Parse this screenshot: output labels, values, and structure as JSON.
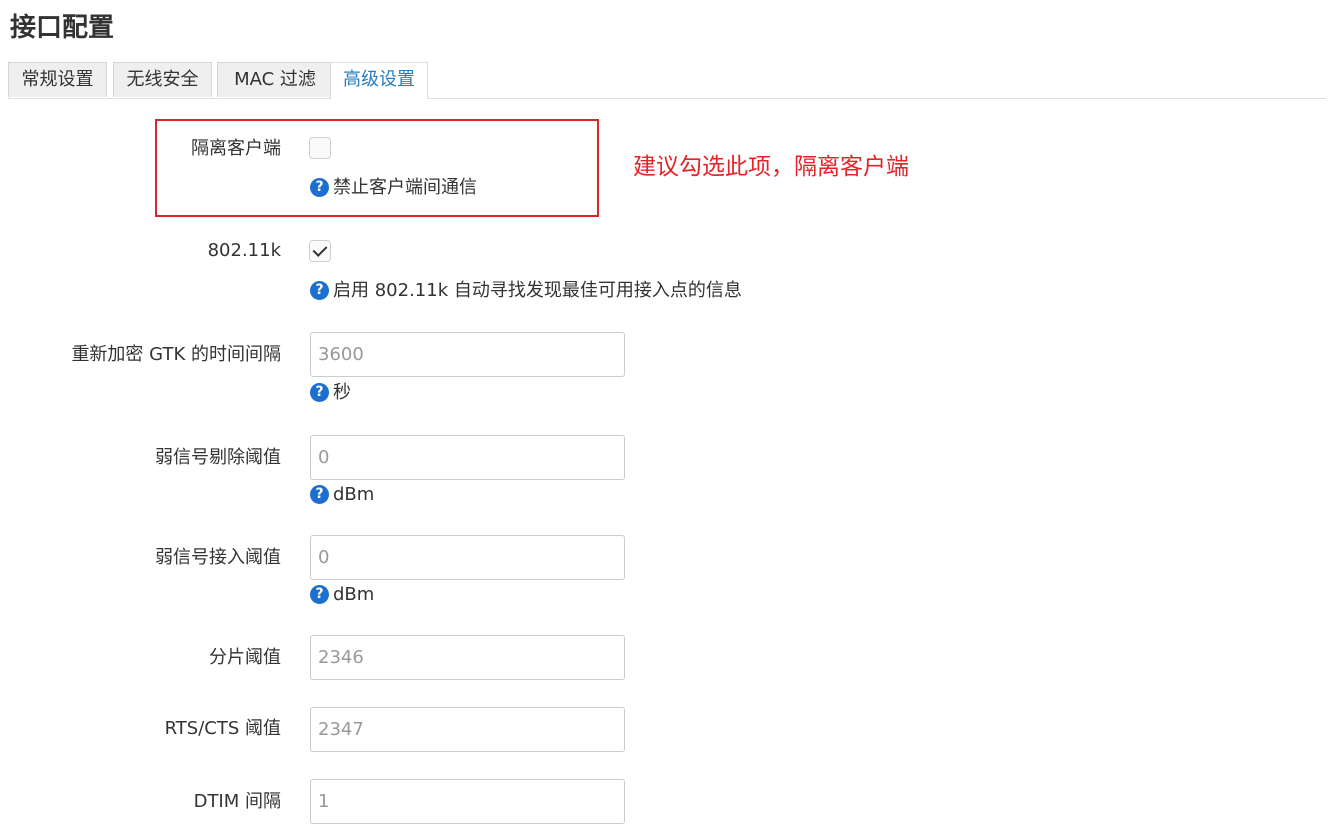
{
  "page": {
    "title": "接口配置"
  },
  "tabs": [
    {
      "label": "常规设置"
    },
    {
      "label": "无线安全"
    },
    {
      "label": "MAC 过滤"
    },
    {
      "label": "高级设置",
      "active": true
    }
  ],
  "annotation": {
    "text": "建议勾选此项，隔离客户端",
    "color": "#e5232a"
  },
  "fields": {
    "isolate": {
      "label": "隔离客户端",
      "checked": false,
      "help": "禁止客户端间通信"
    },
    "dot11k": {
      "label": "802.11k",
      "checked": true,
      "help": "启用 802.11k 自动寻找发现最佳可用接入点的信息"
    },
    "gtk_rekey": {
      "label": "重新加密 GTK 的时间间隔",
      "placeholder": "3600",
      "help": "秒"
    },
    "weak_kick": {
      "label": "弱信号剔除阈值",
      "placeholder": "0",
      "help": "dBm"
    },
    "weak_access": {
      "label": "弱信号接入阈值",
      "placeholder": "0",
      "help": "dBm"
    },
    "frag": {
      "label": "分片阈值",
      "placeholder": "2346"
    },
    "rts": {
      "label": "RTS/CTS 阈值",
      "placeholder": "2347"
    },
    "dtim": {
      "label": "DTIM 间隔",
      "placeholder": "1"
    }
  },
  "help_icon_glyph": "?",
  "colors": {
    "accent": "#2a7ec0",
    "help_icon": "#1d6fcf",
    "highlight_border": "#d9252c"
  }
}
